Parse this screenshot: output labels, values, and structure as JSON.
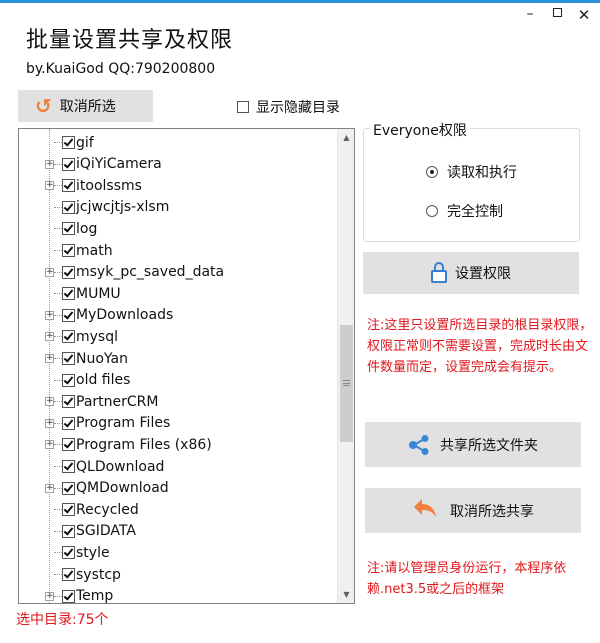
{
  "window": {
    "minimize_glyph": "–",
    "close_glyph": "✕"
  },
  "header": {
    "title": "批量设置共享及权限",
    "subtitle": "by.KuaiGod  QQ:790200800"
  },
  "toolbar": {
    "cancel_selection_label": "取消所选",
    "show_hidden_label": "显示隐藏目录",
    "show_hidden_checked": false
  },
  "tree": {
    "items": [
      {
        "label": "gif",
        "expandable": false,
        "checked": true
      },
      {
        "label": "iQiYiCamera",
        "expandable": true,
        "checked": true
      },
      {
        "label": "itoolssms",
        "expandable": true,
        "checked": true
      },
      {
        "label": "jcjwcjtjs-xlsm",
        "expandable": false,
        "checked": true
      },
      {
        "label": "log",
        "expandable": false,
        "checked": true
      },
      {
        "label": "math",
        "expandable": false,
        "checked": true
      },
      {
        "label": "msyk_pc_saved_data",
        "expandable": true,
        "checked": true
      },
      {
        "label": "MUMU",
        "expandable": false,
        "checked": true
      },
      {
        "label": "MyDownloads",
        "expandable": true,
        "checked": true
      },
      {
        "label": "mysql",
        "expandable": true,
        "checked": true
      },
      {
        "label": "NuoYan",
        "expandable": true,
        "checked": true
      },
      {
        "label": "old files",
        "expandable": false,
        "checked": true
      },
      {
        "label": "PartnerCRM",
        "expandable": true,
        "checked": true
      },
      {
        "label": "Program Files",
        "expandable": true,
        "checked": true
      },
      {
        "label": "Program Files (x86)",
        "expandable": true,
        "checked": true
      },
      {
        "label": "QLDownload",
        "expandable": false,
        "checked": true
      },
      {
        "label": "QMDownload",
        "expandable": true,
        "checked": true
      },
      {
        "label": "Recycled",
        "expandable": false,
        "checked": true
      },
      {
        "label": "SGIDATA",
        "expandable": false,
        "checked": true
      },
      {
        "label": "style",
        "expandable": false,
        "checked": true
      },
      {
        "label": "systcp",
        "expandable": false,
        "checked": true
      },
      {
        "label": "Temp",
        "expandable": true,
        "checked": true
      }
    ],
    "scroll_position": 0.42
  },
  "permissions": {
    "group_title": "Everyone权限",
    "options": [
      {
        "label": "读取和执行",
        "selected": true
      },
      {
        "label": "完全控制",
        "selected": false
      }
    ],
    "set_button_label": "设置权限"
  },
  "notes": {
    "note1": "注:这里只设置所选目录的根目录权限，权限正常则不需要设置，完成时长由文件数量而定，设置完成会有提示。",
    "note2": "注:请以管理员身份运行，本程序依赖.net3.5或之后的框架"
  },
  "actions": {
    "share_label": "共享所选文件夹",
    "unshare_label": "取消所选共享"
  },
  "status": {
    "selected_count_text": "选中目录:75个"
  },
  "colors": {
    "accent_orange": "#f0803c",
    "accent_blue": "#3a86d4",
    "warning_red": "#e0171c",
    "button_gray": "#e1e1e1"
  }
}
